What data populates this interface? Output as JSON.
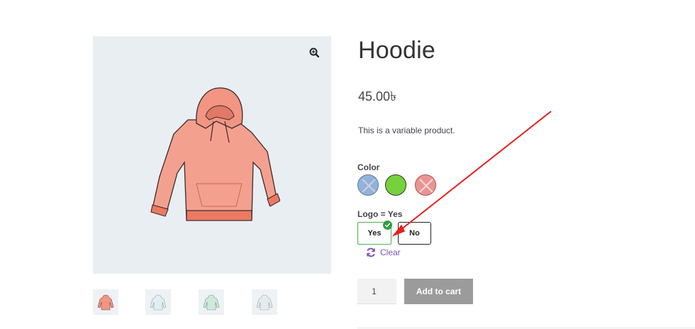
{
  "product": {
    "title": "Hoodie",
    "price": "45.00৳",
    "description": "This is a variable product."
  },
  "gallery": {
    "zoom_icon": "zoom-in-icon",
    "thumbnails": [
      "hoodie-pink",
      "hoodie-light-blue",
      "hoodie-mint",
      "hoodie-pale"
    ]
  },
  "attributes": {
    "color_label": "Color",
    "color_swatches": [
      {
        "name": "blue",
        "color": "#8fb3d9",
        "available": false
      },
      {
        "name": "green",
        "color": "#76d13b",
        "available": true
      },
      {
        "name": "pink",
        "color": "#eb9492",
        "available": false
      }
    ],
    "logo_label": "Logo = Yes",
    "logo_options": [
      "Yes",
      "No"
    ],
    "logo_selected": "Yes"
  },
  "clear_label": "Clear",
  "cart": {
    "quantity": "1",
    "add_to_cart_label": "Add to cart"
  },
  "colors": {
    "accent": "#7f54b3",
    "selected_border": "#4caf50",
    "annotation_arrow": "#e81e1e"
  }
}
